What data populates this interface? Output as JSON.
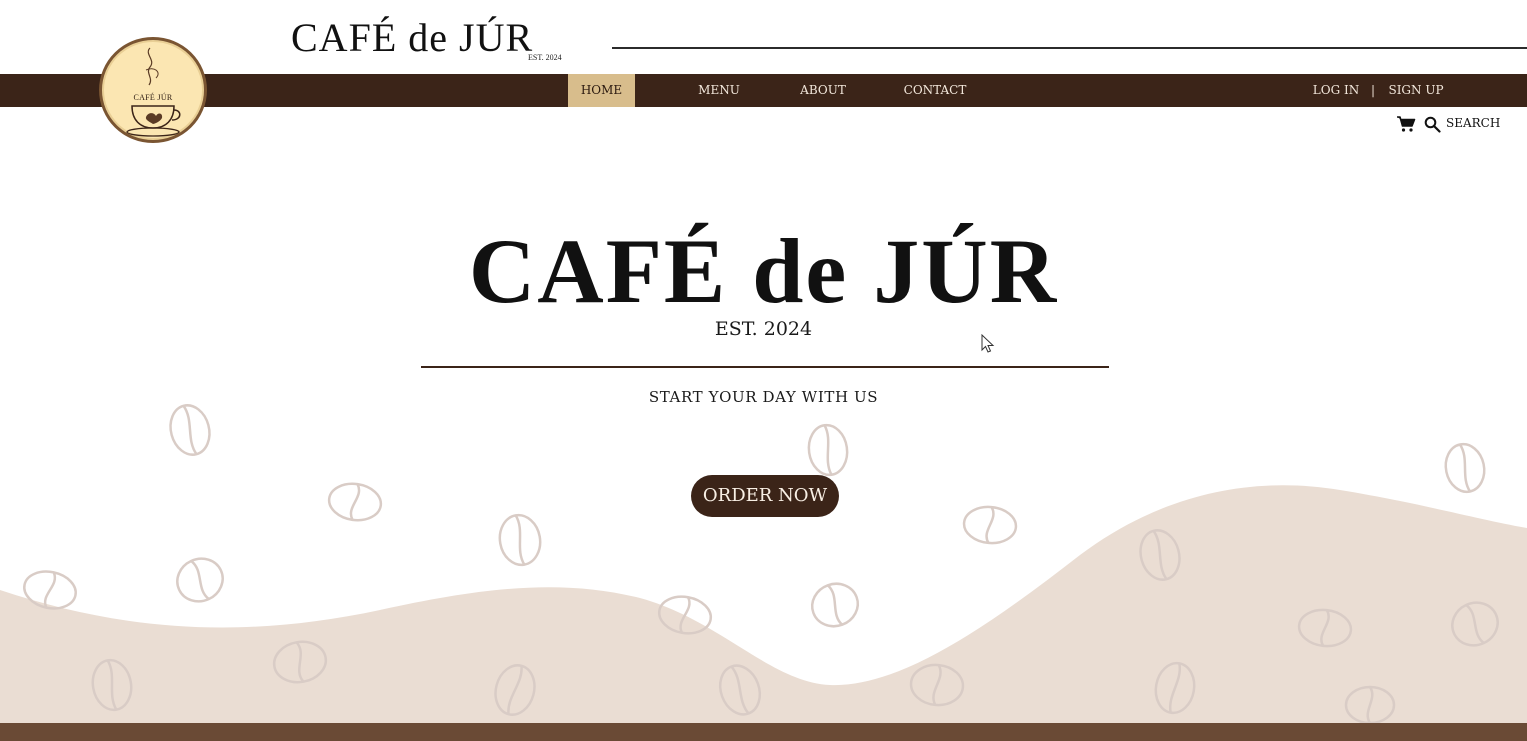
{
  "header": {
    "brand": "CAFÉ de JÚR",
    "est": "EST. 2024"
  },
  "logo": {
    "text": "CAFÉ JÚR"
  },
  "nav": {
    "items": [
      {
        "label": "HOME",
        "active": true
      },
      {
        "label": "MENU",
        "active": false
      },
      {
        "label": "ABOUT",
        "active": false
      },
      {
        "label": "CONTACT",
        "active": false
      }
    ],
    "login": "LOG IN",
    "separator": "|",
    "signup": "SIGN UP"
  },
  "tools": {
    "search_label": "SEARCH",
    "icons": [
      "cart-icon",
      "search-icon"
    ]
  },
  "hero": {
    "title": "CAFÉ de JÚR",
    "est": "EST. 2024",
    "tagline": "START YOUR DAY WITH US",
    "cta": "ORDER NOW"
  },
  "colors": {
    "brown_dark": "#3b2418",
    "nav_active": "#d8bd8c",
    "wave": "#eaddd3",
    "bean_outline": "#d9ccc6",
    "footer": "#6a4a35",
    "logo_fill": "#fbe6b2"
  }
}
